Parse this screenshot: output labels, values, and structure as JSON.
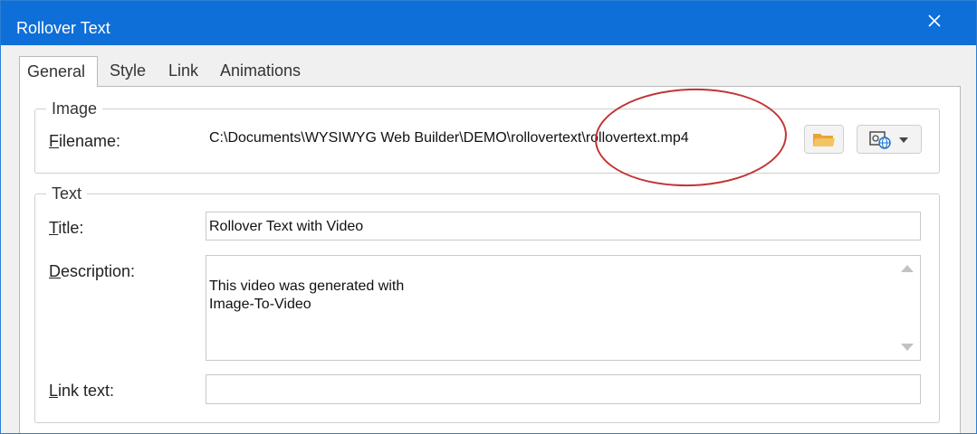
{
  "window": {
    "title": "Rollover Text"
  },
  "tabs": [
    {
      "label": "General",
      "active": true
    },
    {
      "label": "Style"
    },
    {
      "label": "Link"
    },
    {
      "label": "Animations"
    }
  ],
  "image_group": {
    "legend": "Image",
    "filename_label_rest": "ilename:",
    "filename_label_hotkey": "F",
    "filename_value": "C:\\Documents\\WYSIWYG Web Builder\\DEMO\\rollovertext\\rollovertext.mp4"
  },
  "text_group": {
    "legend": "Text",
    "title_label_hotkey": "T",
    "title_label_rest": "itle:",
    "title_value": "Rollover Text with Video",
    "description_label_hotkey": "D",
    "description_label_rest": "escription:",
    "description_value": "This video was generated with\nImage-To-Video",
    "linktext_label_hotkey": "L",
    "linktext_label_rest": "ink text:",
    "linktext_value": ""
  },
  "icons": {
    "close": "close-icon",
    "folder": "folder-icon",
    "web-image": "image-globe-icon",
    "dropdown": "chevron-down-icon"
  },
  "colors": {
    "titlebar": "#0f6fd8",
    "annotation": "#c23434",
    "folder": "#f2b84b"
  }
}
